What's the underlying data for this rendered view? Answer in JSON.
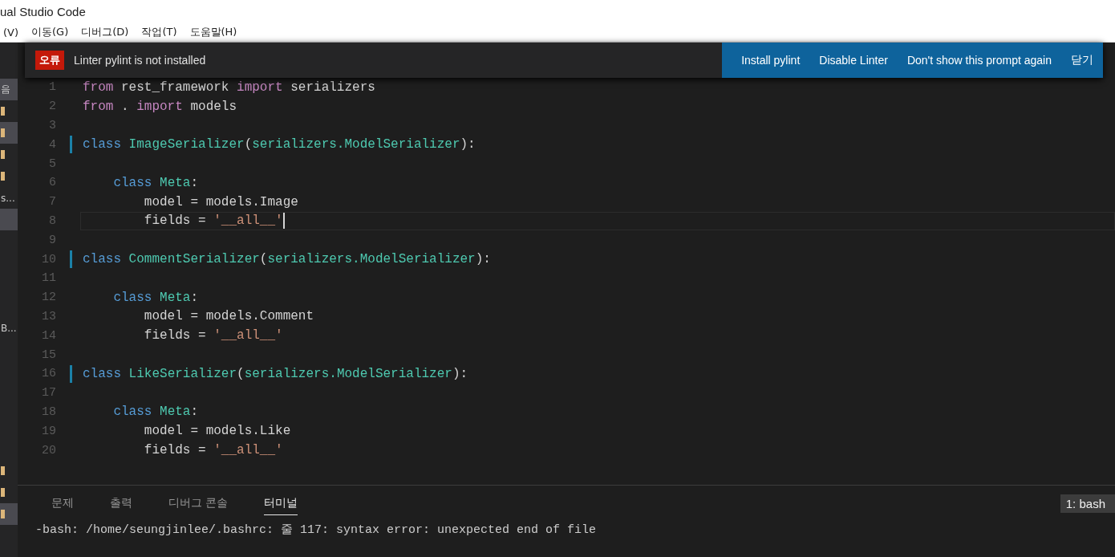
{
  "window": {
    "title": "ual Studio Code"
  },
  "menu": [
    "(V)",
    "이동(G)",
    "디버그(D)",
    "작업(T)",
    "도움말(H)"
  ],
  "notification": {
    "severity": "오류",
    "message": "Linter pylint is not installed",
    "actions": [
      "Install pylint",
      "Disable Linter",
      "Don't show this prompt again",
      "닫기"
    ]
  },
  "sidebar": {
    "items": [
      {
        "kind": "text",
        "label": "음",
        "selected": true
      },
      {
        "kind": "folder",
        "selected": false
      },
      {
        "kind": "folder",
        "selected": true
      },
      {
        "kind": "folder",
        "selected": false
      },
      {
        "kind": "folder",
        "selected": false
      },
      {
        "kind": "text",
        "label": "s...",
        "selected": false
      },
      {
        "kind": "blank",
        "selected": true
      },
      {
        "kind": "text",
        "label": "B...",
        "selected": false
      }
    ],
    "bottom_items": [
      {
        "kind": "folder",
        "selected": false
      },
      {
        "kind": "folder",
        "selected": false
      },
      {
        "kind": "folder",
        "selected": true
      }
    ]
  },
  "editor": {
    "lines": [
      {
        "number": "1",
        "modified": false,
        "current": false,
        "tokens": [
          {
            "kind": "keyword",
            "text": "from"
          },
          {
            "kind": "plain",
            "text": " rest_framework"
          },
          {
            "kind": "keyword",
            "text": " import"
          },
          {
            "kind": "plain",
            "text": " serializers"
          }
        ]
      },
      {
        "number": "2",
        "modified": false,
        "current": false,
        "tokens": [
          {
            "kind": "keyword",
            "text": "from"
          },
          {
            "kind": "plain",
            "text": " ."
          },
          {
            "kind": "keyword",
            "text": " import"
          },
          {
            "kind": "plain",
            "text": " models"
          }
        ]
      },
      {
        "number": "3",
        "modified": false,
        "current": false
      },
      {
        "number": "4",
        "modified": true,
        "current": false,
        "tokens": [
          {
            "kind": "storage",
            "text": "class"
          },
          {
            "kind": "type",
            "text": " ImageSerializer"
          },
          {
            "kind": "plain",
            "text": "("
          },
          {
            "kind": "type",
            "text": "serializers.ModelSerializer"
          },
          {
            "kind": "plain",
            "text": "):"
          }
        ]
      },
      {
        "number": "5",
        "modified": false,
        "current": false
      },
      {
        "number": "6",
        "modified": false,
        "current": false,
        "tokens": [
          {
            "kind": "storage",
            "text": "    class"
          },
          {
            "kind": "type",
            "text": " Meta"
          },
          {
            "kind": "plain",
            "text": ":"
          }
        ]
      },
      {
        "number": "7",
        "modified": false,
        "current": false,
        "tokens": [
          {
            "kind": "plain",
            "text": "        model = models.Image"
          }
        ]
      },
      {
        "number": "8",
        "modified": false,
        "current": true,
        "tokens": [
          {
            "kind": "plain",
            "text": "        fields ="
          },
          {
            "kind": "string",
            "text": " '__all__'"
          }
        ]
      },
      {
        "number": "9",
        "modified": false,
        "current": false
      },
      {
        "number": "10",
        "modified": true,
        "current": false,
        "tokens": [
          {
            "kind": "storage",
            "text": "class"
          },
          {
            "kind": "type",
            "text": " CommentSerializer"
          },
          {
            "kind": "plain",
            "text": "("
          },
          {
            "kind": "type",
            "text": "serializers.ModelSerializer"
          },
          {
            "kind": "plain",
            "text": "):"
          }
        ]
      },
      {
        "number": "11",
        "modified": false,
        "current": false
      },
      {
        "number": "12",
        "modified": false,
        "current": false,
        "tokens": [
          {
            "kind": "storage",
            "text": "    class"
          },
          {
            "kind": "type",
            "text": " Meta"
          },
          {
            "kind": "plain",
            "text": ":"
          }
        ]
      },
      {
        "number": "13",
        "modified": false,
        "current": false,
        "tokens": [
          {
            "kind": "plain",
            "text": "        model = models.Comment"
          }
        ]
      },
      {
        "number": "14",
        "modified": false,
        "current": false,
        "tokens": [
          {
            "kind": "plain",
            "text": "        fields ="
          },
          {
            "kind": "string",
            "text": " '__all__'"
          }
        ]
      },
      {
        "number": "15",
        "modified": false,
        "current": false
      },
      {
        "number": "16",
        "modified": true,
        "current": false,
        "tokens": [
          {
            "kind": "storage",
            "text": "class"
          },
          {
            "kind": "type",
            "text": " LikeSerializer"
          },
          {
            "kind": "plain",
            "text": "("
          },
          {
            "kind": "type",
            "text": "serializers.ModelSerializer"
          },
          {
            "kind": "plain",
            "text": "):"
          }
        ]
      },
      {
        "number": "17",
        "modified": false,
        "current": false
      },
      {
        "number": "18",
        "modified": false,
        "current": false,
        "tokens": [
          {
            "kind": "storage",
            "text": "    class"
          },
          {
            "kind": "type",
            "text": " Meta"
          },
          {
            "kind": "plain",
            "text": ":"
          }
        ]
      },
      {
        "number": "19",
        "modified": false,
        "current": false,
        "tokens": [
          {
            "kind": "plain",
            "text": "        model = models.Like"
          }
        ]
      },
      {
        "number": "20",
        "modified": false,
        "current": false,
        "tokens": [
          {
            "kind": "plain",
            "text": "        fields ="
          },
          {
            "kind": "string",
            "text": " '__all__'"
          }
        ]
      }
    ]
  },
  "panel": {
    "tabs": [
      {
        "label": "문제",
        "selected": false
      },
      {
        "label": "출력",
        "selected": false
      },
      {
        "label": "디버그 콘솔",
        "selected": false
      },
      {
        "label": "터미널",
        "selected": true
      }
    ],
    "terminal_select": "1: bash",
    "terminal": [
      "-bash: /home/seungjinlee/.bashrc: 줄 117: syntax error: unexpected end of file"
    ]
  }
}
